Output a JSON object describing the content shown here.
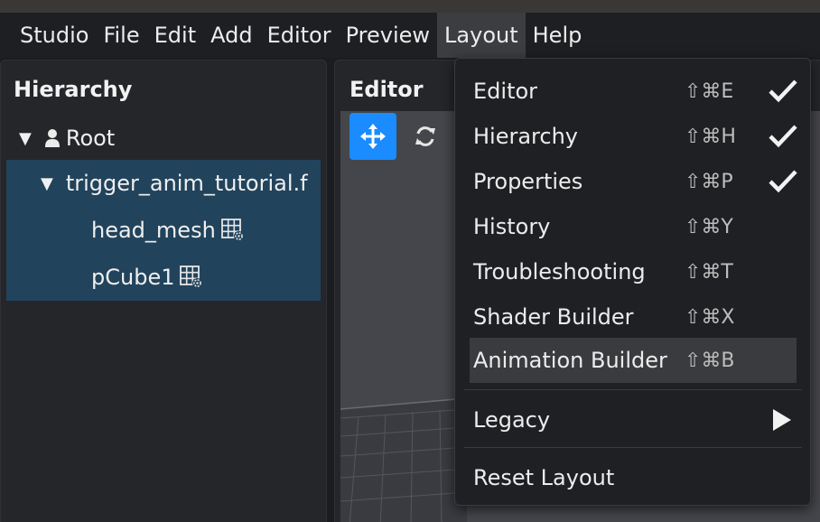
{
  "menubar": {
    "items": [
      {
        "label": "Studio"
      },
      {
        "label": "File"
      },
      {
        "label": "Edit"
      },
      {
        "label": "Add"
      },
      {
        "label": "Editor"
      },
      {
        "label": "Preview"
      },
      {
        "label": "Layout"
      },
      {
        "label": "Help"
      }
    ],
    "active": "Layout"
  },
  "hierarchy": {
    "title": "Hierarchy",
    "root_label": "Root",
    "file_label": "trigger_anim_tutorial.f",
    "children": [
      {
        "label": "head_mesh"
      },
      {
        "label": "pCube1"
      }
    ]
  },
  "editor": {
    "title": "Editor",
    "tools": [
      {
        "icon": "move-icon",
        "active": true
      },
      {
        "icon": "refresh-icon",
        "active": false
      }
    ]
  },
  "layout_menu": {
    "items": [
      {
        "label": "Editor",
        "shortcut": "⇧⌘E",
        "checked": true
      },
      {
        "label": "Hierarchy",
        "shortcut": "⇧⌘H",
        "checked": true
      },
      {
        "label": "Properties",
        "shortcut": "⇧⌘P",
        "checked": true
      },
      {
        "label": "History",
        "shortcut": "⇧⌘Y",
        "checked": false
      },
      {
        "label": "Troubleshooting",
        "shortcut": "⇧⌘T",
        "checked": false
      },
      {
        "label": "Shader Builder",
        "shortcut": "⇧⌘X",
        "checked": false
      },
      {
        "label": "Animation Builder",
        "shortcut": "⇧⌘B",
        "checked": false,
        "hovered": true
      }
    ],
    "legacy_label": "Legacy",
    "reset_label": "Reset Layout"
  },
  "colors": {
    "accent": "#1a8cff",
    "selection": "#22435c",
    "menu_bg": "#1f2023"
  }
}
